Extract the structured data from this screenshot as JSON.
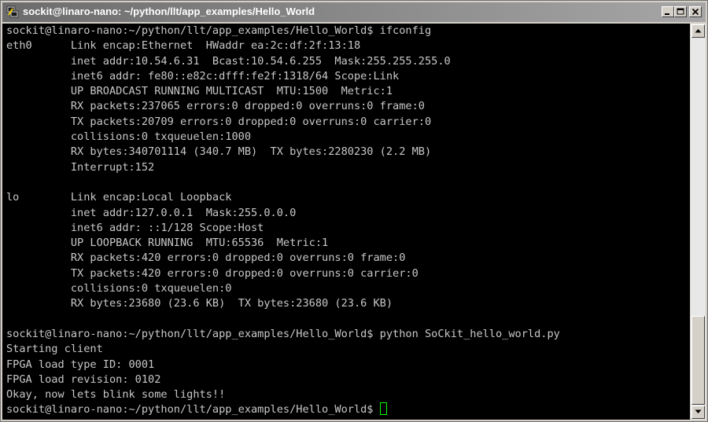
{
  "window": {
    "title": "sockit@linaro-nano: ~/python/llt/app_examples/Hello_World",
    "app_icon": "putty-icon",
    "controls": [
      "minimize-icon",
      "maximize-icon",
      "close-icon"
    ]
  },
  "terminal": {
    "text_color": "#c8c8c8",
    "background": "#000000",
    "cursor_color": "#00ff00",
    "lines": [
      "sockit@linaro-nano:~/python/llt/app_examples/Hello_World$ ifconfig",
      "eth0      Link encap:Ethernet  HWaddr ea:2c:df:2f:13:18",
      "          inet addr:10.54.6.31  Bcast:10.54.6.255  Mask:255.255.255.0",
      "          inet6 addr: fe80::e82c:dfff:fe2f:1318/64 Scope:Link",
      "          UP BROADCAST RUNNING MULTICAST  MTU:1500  Metric:1",
      "          RX packets:237065 errors:0 dropped:0 overruns:0 frame:0",
      "          TX packets:20709 errors:0 dropped:0 overruns:0 carrier:0",
      "          collisions:0 txqueuelen:1000",
      "          RX bytes:340701114 (340.7 MB)  TX bytes:2280230 (2.2 MB)",
      "          Interrupt:152",
      "",
      "lo        Link encap:Local Loopback",
      "          inet addr:127.0.0.1  Mask:255.0.0.0",
      "          inet6 addr: ::1/128 Scope:Host",
      "          UP LOOPBACK RUNNING  MTU:65536  Metric:1",
      "          RX packets:420 errors:0 dropped:0 overruns:0 frame:0",
      "          TX packets:420 errors:0 dropped:0 overruns:0 carrier:0",
      "          collisions:0 txqueuelen:0",
      "          RX bytes:23680 (23.6 KB)  TX bytes:23680 (23.6 KB)",
      "",
      "sockit@linaro-nano:~/python/llt/app_examples/Hello_World$ python SoCkit_hello_world.py",
      "Starting client",
      "FPGA load type ID: 0001",
      "FPGA load revision: 0102",
      "Okay, now lets blink some lights!!",
      "sockit@linaro-nano:~/python/llt/app_examples/Hello_World$ "
    ]
  },
  "scrollbar": {
    "up_icon": "arrow-up-icon",
    "down_icon": "arrow-down-icon"
  }
}
